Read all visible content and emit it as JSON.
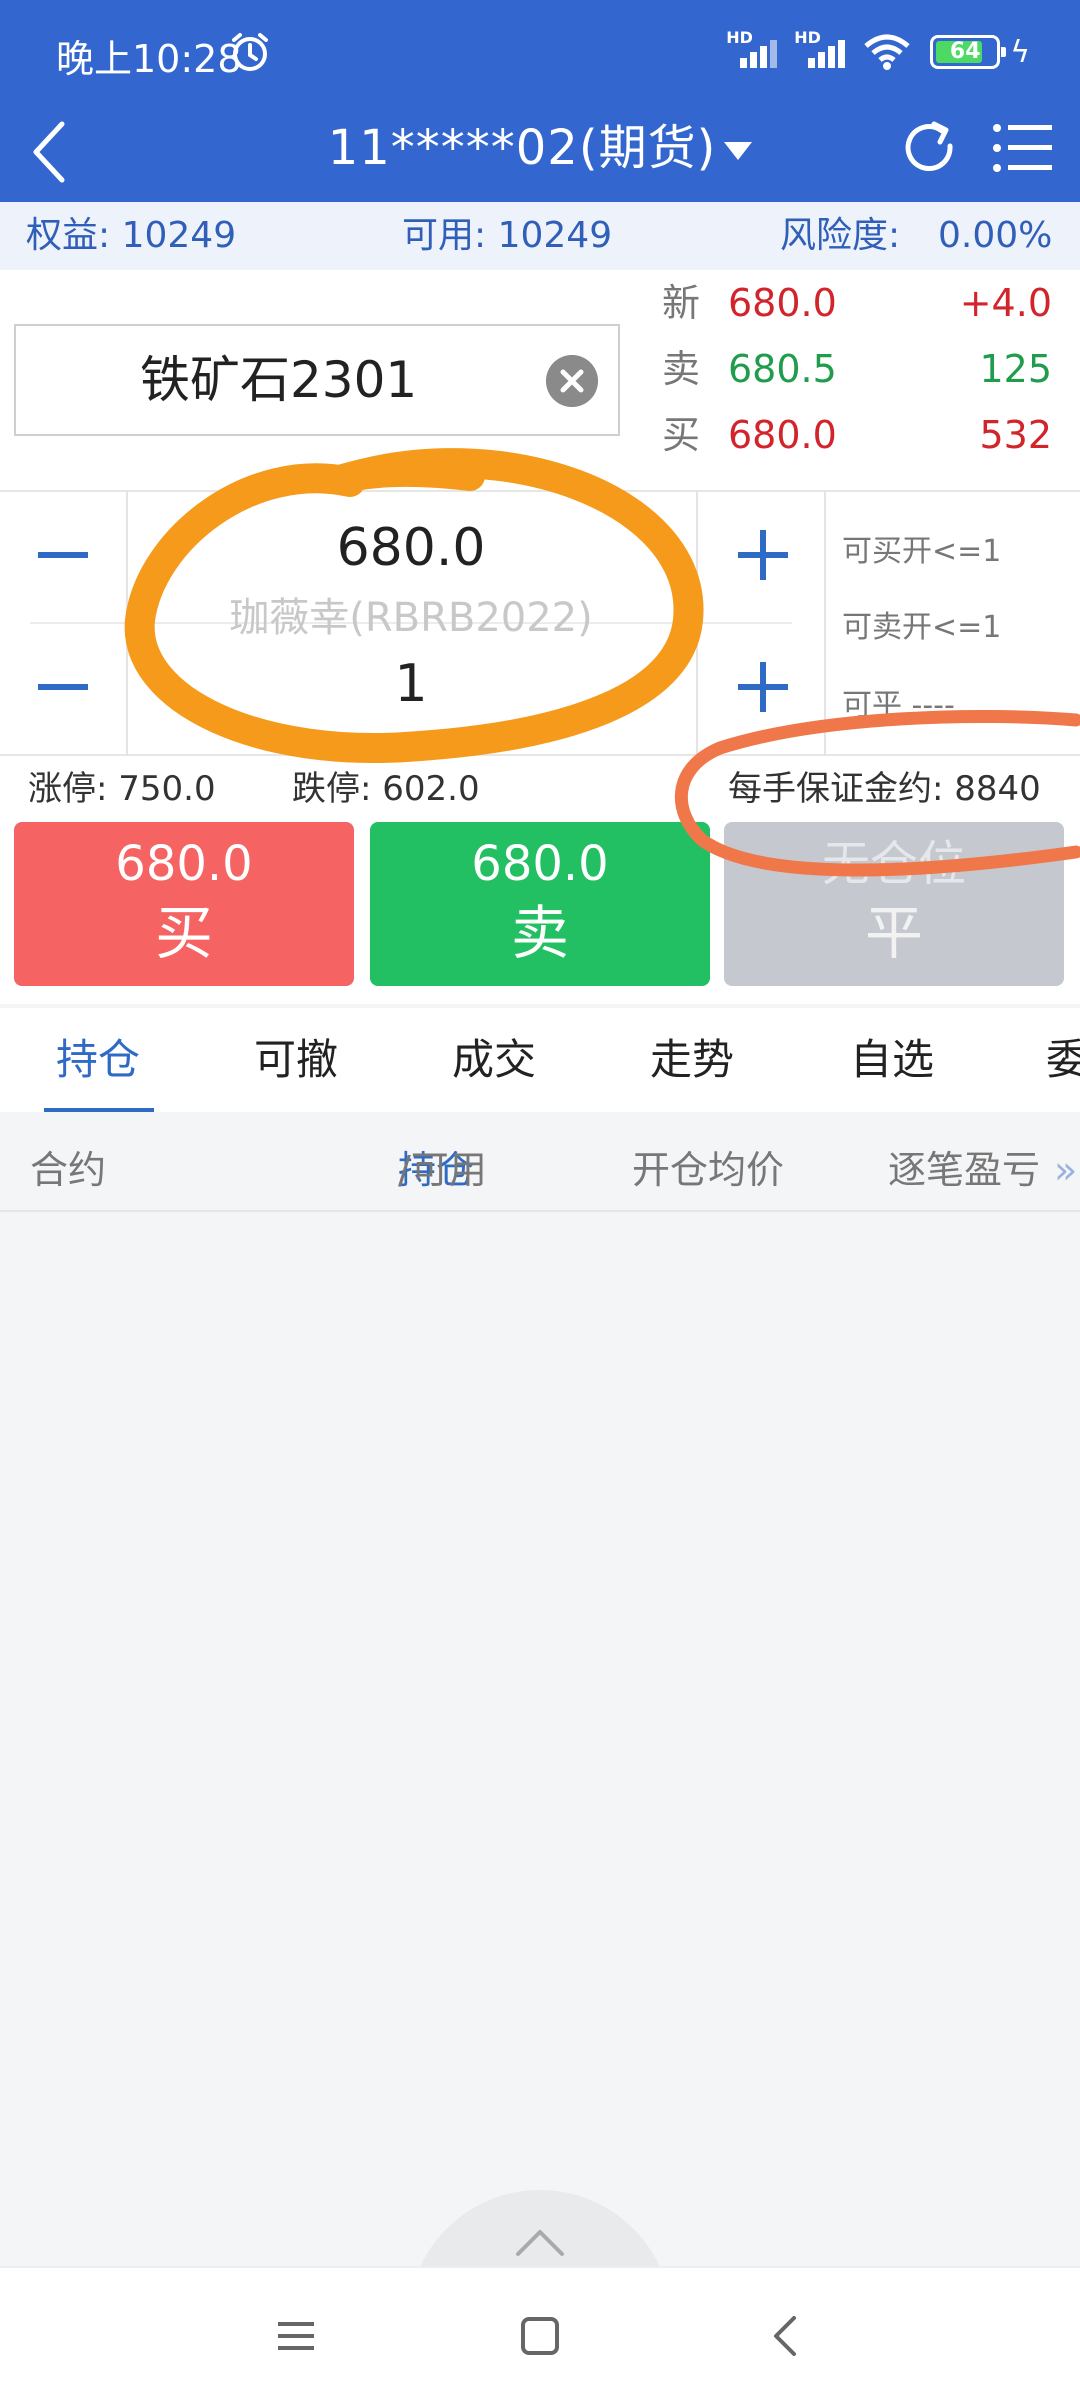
{
  "status_bar": {
    "time": "晚上10:28",
    "hd1": "HD",
    "hd2": "HD",
    "battery": "64"
  },
  "header": {
    "title": "11*****02(期货)"
  },
  "account": {
    "equity": "权益: 10249",
    "available": "可用: 10249",
    "risk_label": "风险度:",
    "risk_value": "0.00%"
  },
  "instrument": {
    "name": "铁矿石2301"
  },
  "quote": {
    "last_label": "新",
    "last_price": "680.0",
    "change": "+4.0",
    "ask_label": "卖",
    "ask_price": "680.5",
    "ask_volume": "125",
    "bid_label": "买",
    "bid_price": "680.0",
    "bid_volume": "532"
  },
  "order": {
    "price": "680.0",
    "quantity": "1",
    "watermark": "珈薇幸(RBRB2022)",
    "can_buy_open": "可买开<=1",
    "can_sell_open": "可卖开<=1",
    "can_close": "可平 ----"
  },
  "limits": {
    "limit_up": "涨停: 750.0",
    "limit_down": "跌停: 602.0",
    "margin_per_lot": "每手保证金约: 8840"
  },
  "actions": {
    "buy_price": "680.0",
    "buy_label": "买",
    "sell_price": "680.0",
    "sell_label": "卖",
    "close_text": "无仓位",
    "close_label": "平"
  },
  "tabs": [
    "持仓",
    "可撤",
    "成交",
    "走势",
    "自选",
    "委"
  ],
  "columns": {
    "contract": "合约",
    "position": "持仓",
    "slash_available": "/可用",
    "avg_open": "开仓均价",
    "pnl": "逐笔盈亏",
    "more": "»"
  },
  "colors": {
    "header_blue": "#3367cf",
    "buy_red": "#f56363",
    "sell_green": "#22c062",
    "annotation_orange": "#f59a1b",
    "annotation_coral": "#f0774a"
  }
}
